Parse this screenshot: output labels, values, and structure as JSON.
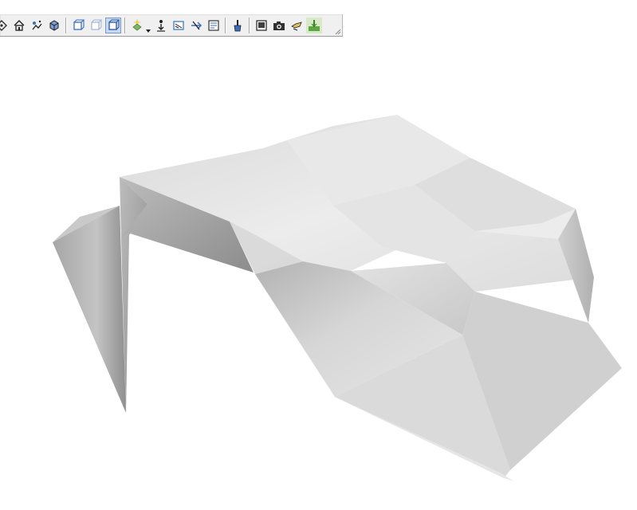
{
  "toolbar": {
    "buttons": [
      {
        "name": "rotate-icon",
        "pressed": false
      },
      {
        "name": "home-icon",
        "pressed": false
      },
      {
        "name": "fly-to-icon",
        "pressed": false
      },
      {
        "name": "cube-view-icon",
        "pressed": false
      },
      {
        "name": "perspective-icon",
        "pressed": false
      },
      {
        "name": "orthographic-icon",
        "pressed": false
      },
      {
        "name": "view-mode-icon",
        "pressed": true
      },
      {
        "name": "lighting-icon",
        "pressed": false
      },
      {
        "name": "gravity-icon",
        "pressed": false
      },
      {
        "name": "section-icon",
        "pressed": false
      },
      {
        "name": "collision-icon",
        "pressed": false
      },
      {
        "name": "stats-icon",
        "pressed": false
      },
      {
        "name": "paintbrush-icon",
        "pressed": false
      },
      {
        "name": "snapshot-icon",
        "pressed": false
      },
      {
        "name": "camera-icon",
        "pressed": false
      },
      {
        "name": "headlight-icon",
        "pressed": false
      },
      {
        "name": "terrain-icon",
        "pressed": false
      }
    ]
  },
  "colors": {
    "toolbar_bg": "#f0f0f0",
    "accent": "#3a6ec0",
    "surface_light": "#ececec",
    "surface_mid": "#d2d2d2",
    "surface_dark": "#9c9c9c",
    "background": "#ffffff"
  }
}
